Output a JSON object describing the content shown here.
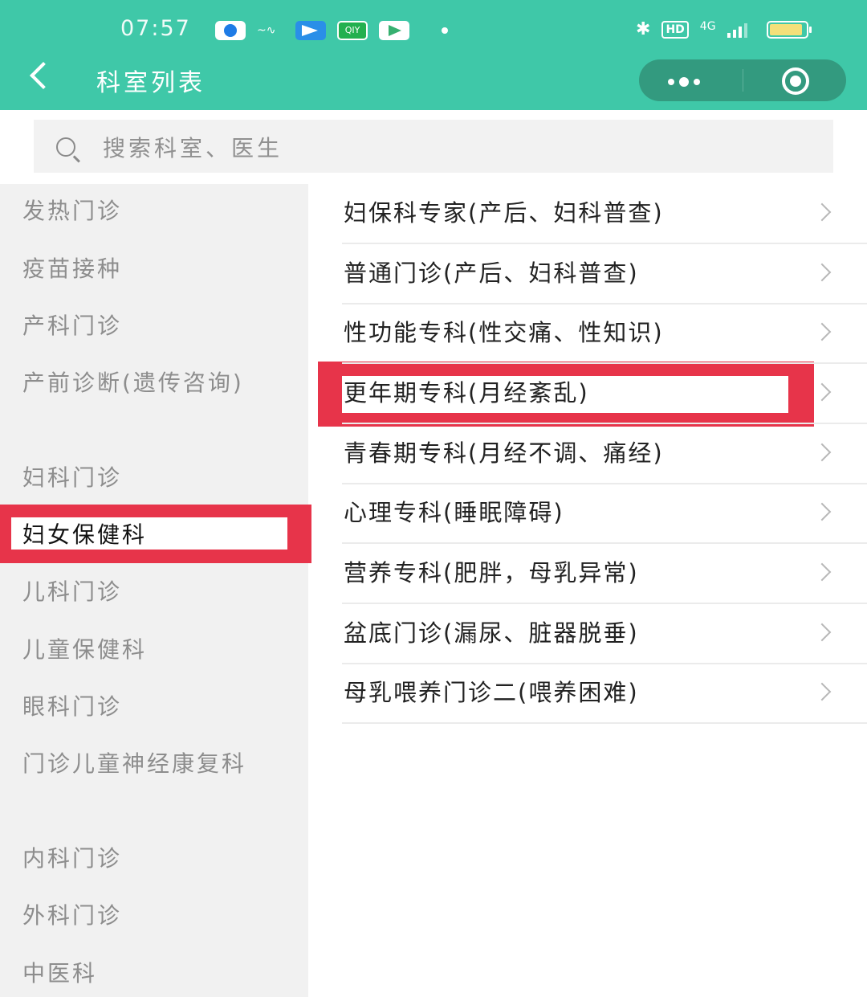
{
  "status_bar": {
    "time": "07:57",
    "left_icons": [
      "app-icon",
      "app-icon",
      "app-icon",
      "iqiyi-icon",
      "app-icon"
    ],
    "iqiyi_label": "QIY",
    "signal_label": "4G",
    "hd_label": "HD"
  },
  "header": {
    "title": "科室列表",
    "accent_color": "#3fc8a8"
  },
  "search": {
    "placeholder": "搜索科室、医生"
  },
  "sidebar": {
    "items": [
      {
        "label": "发热门诊"
      },
      {
        "label": "疫苗接种"
      },
      {
        "label": "产科门诊"
      },
      {
        "label": "产前诊断(遗传咨询)"
      },
      {
        "label": "妇科门诊"
      },
      {
        "label": "妇女保健科",
        "selected": true
      },
      {
        "label": "儿科门诊"
      },
      {
        "label": "儿童保健科"
      },
      {
        "label": "眼科门诊"
      },
      {
        "label": "门诊儿童神经康复科"
      },
      {
        "label": "内科门诊"
      },
      {
        "label": "外科门诊"
      },
      {
        "label": "中医科"
      }
    ],
    "highlight_color": "#e7344a"
  },
  "departments": [
    {
      "label": "妇保科专家(产后、妇科普查)"
    },
    {
      "label": "普通门诊(产后、妇科普查)"
    },
    {
      "label": "性功能专科(性交痛、性知识)"
    },
    {
      "label": "更年期专科(月经紊乱)",
      "highlighted": true
    },
    {
      "label": "青春期专科(月经不调、痛经)"
    },
    {
      "label": "心理专科(睡眠障碍)"
    },
    {
      "label": "营养专科(肥胖，母乳异常)"
    },
    {
      "label": "盆底门诊(漏尿、脏器脱垂)"
    },
    {
      "label": "母乳喂养门诊二(喂养困难)"
    }
  ]
}
